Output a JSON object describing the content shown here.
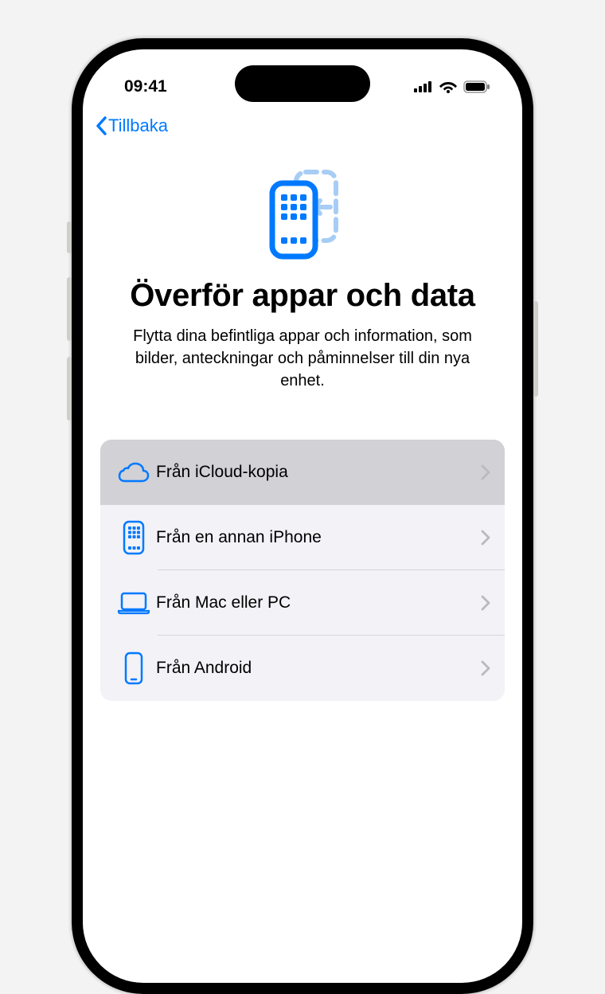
{
  "status": {
    "time": "09:41"
  },
  "nav": {
    "back_label": "Tillbaka"
  },
  "hero": {
    "title": "Överför appar och data",
    "description": "Flytta dina befintliga appar och information, som bilder, anteckningar och påminnelser till din nya enhet."
  },
  "options": {
    "icloud": "Från iCloud-kopia",
    "iphone": "Från en annan iPhone",
    "macpc": "Från Mac eller PC",
    "android": "Från Android"
  }
}
